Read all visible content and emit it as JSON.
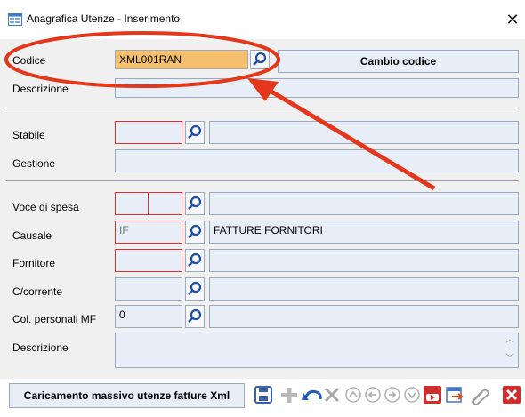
{
  "window": {
    "title": "Anagrafica Utenze - Inserimento"
  },
  "section1": {
    "codice_label": "Codice",
    "codice_value": "XML001RAN",
    "cambio_codice_label": "Cambio codice",
    "descrizione_label": "Descrizione",
    "descrizione_value": ""
  },
  "section2": {
    "stabile_label": "Stabile",
    "gestione_label": "Gestione"
  },
  "section3": {
    "voce_label": "Voce di spesa",
    "causale_label": "Causale",
    "causale_code": "IF",
    "causale_desc": "FATTURE FORNITORI",
    "fornitore_label": "Fornitore",
    "ccorrente_label": "C/corrente",
    "colpers_label": "Col. personali MF",
    "colpers_value": "0",
    "descrizione_label": "Descrizione"
  },
  "bottom": {
    "mass_load_label": "Caricamento massivo utenze fatture Xml"
  },
  "colors": {
    "annotation_red": "#e4371b",
    "required_border": "#e22b2b",
    "highlight": "#f5c06e"
  }
}
